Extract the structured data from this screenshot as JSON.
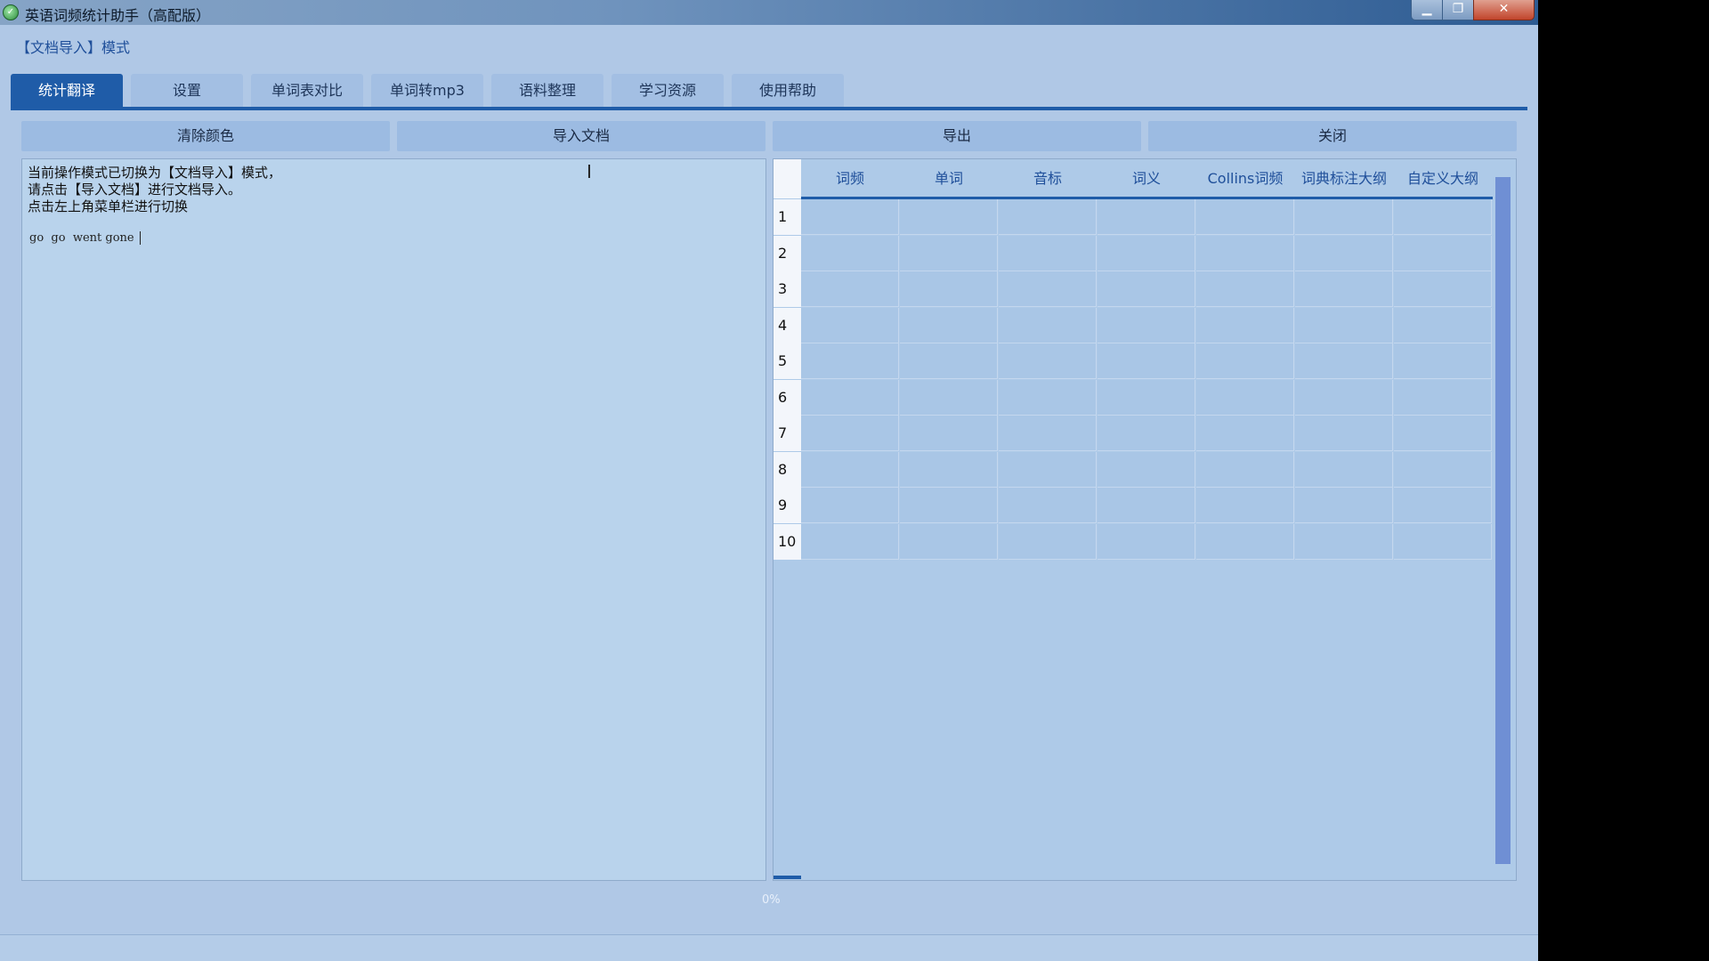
{
  "window": {
    "title": "英语词频统计助手（高配版）"
  },
  "mode_label": "【文档导入】模式",
  "tabs": [
    {
      "label": "统计翻译",
      "active": true
    },
    {
      "label": "设置"
    },
    {
      "label": "单词表对比"
    },
    {
      "label": "单词转mp3"
    },
    {
      "label": "语料整理"
    },
    {
      "label": "学习资源"
    },
    {
      "label": "使用帮助"
    }
  ],
  "actions": {
    "clear_color": "清除颜色",
    "import_doc": "导入文档",
    "export": "导出",
    "close": "关闭"
  },
  "text_area": {
    "lines": [
      "当前操作模式已切换为【文档导入】模式，",
      "请点击【导入文档】进行文档导入。",
      "点击左上角菜单栏进行切换"
    ],
    "words": "go  go  went gone "
  },
  "table": {
    "columns": [
      "词频",
      "单词",
      "音标",
      "词义",
      "Collins词频",
      "词典标注大纲",
      "自定义大纲"
    ],
    "row_numbers": [
      "1",
      "2",
      "3",
      "4",
      "5",
      "6",
      "7",
      "8",
      "9",
      "10"
    ]
  },
  "progress": {
    "value": 0,
    "text": "0%"
  },
  "colors": {
    "accent": "#1f5ca8",
    "background": "#b0c8e6",
    "scrollbar": "#6f8fd4"
  },
  "icons": [
    "app-icon",
    "minimize-icon",
    "maximize-icon",
    "close-icon",
    "text-cursor-icon"
  ]
}
